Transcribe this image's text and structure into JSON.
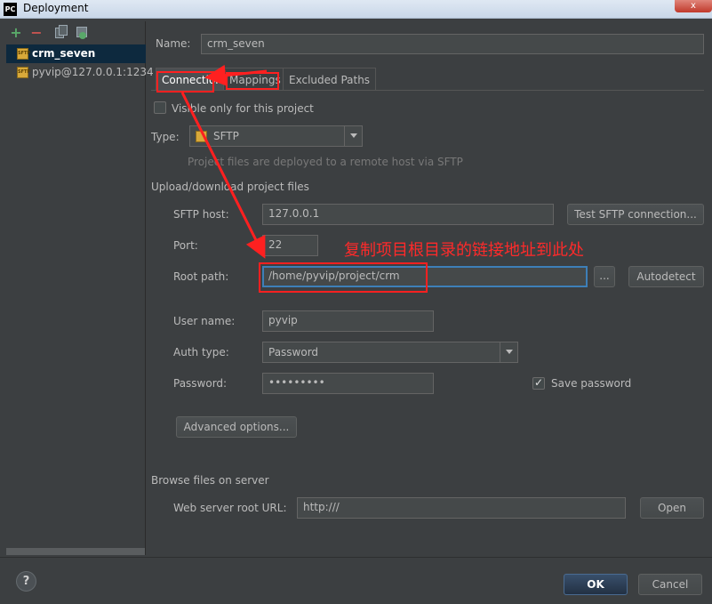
{
  "window": {
    "app_icon": "PC",
    "title": "Deployment",
    "close_glyph": "x"
  },
  "sidebar": {
    "servers": [
      {
        "label": "crm_seven",
        "icon_text": "SFTP",
        "selected": true
      },
      {
        "label": "pyvip@127.0.0.1:1234",
        "icon_text": "SFTP",
        "selected": false
      }
    ]
  },
  "name_field": {
    "label": "Name:",
    "value": "crm_seven"
  },
  "tabs": [
    "Connection",
    "Mappings",
    "Excluded Paths"
  ],
  "connection": {
    "visible_label": "Visible only for this project",
    "visible_checked": false,
    "type_label": "Type:",
    "type_value": "SFTP",
    "type_hint": "Project files are deployed to a remote host via SFTP",
    "upload_section": "Upload/download project files",
    "host_label": "SFTP host:",
    "host_value": "127.0.0.1",
    "test_button": "Test SFTP connection...",
    "port_label": "Port:",
    "port_value": "22",
    "root_label": "Root path:",
    "root_value": "/home/pyvip/project/crm",
    "browse_button": "...",
    "autodetect_button": "Autodetect",
    "user_label": "User name:",
    "user_value": "pyvip",
    "auth_label": "Auth type:",
    "auth_value": "Password",
    "password_label": "Password:",
    "password_value": "•••••••••",
    "save_password_label": "Save password",
    "save_password_checked": true,
    "advanced_button": "Advanced options...",
    "browse_section": "Browse files on server",
    "web_url_label": "Web server root URL:",
    "web_url_value": "http:///",
    "open_button": "Open"
  },
  "annotation": "复制项目根目录的链接地址到此处",
  "footer": {
    "help": "?",
    "ok": "OK",
    "cancel": "Cancel"
  },
  "colors": {
    "background": "#3c3f41",
    "selection": "#0d293e",
    "annotation_red": "#ff2020",
    "ok_button": "#2c4a6e"
  }
}
